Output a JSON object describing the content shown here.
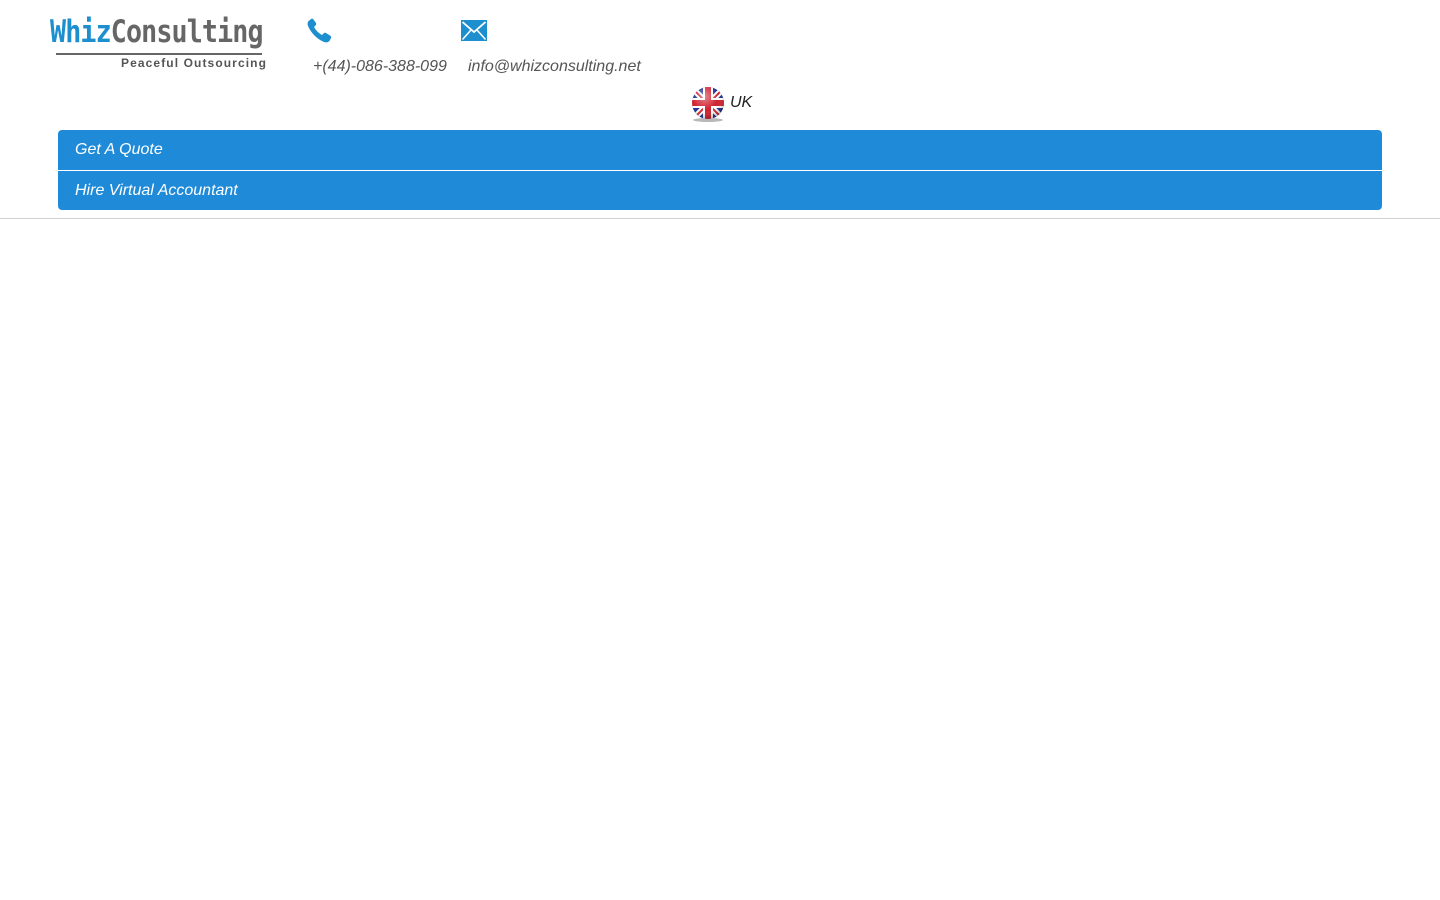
{
  "logo": {
    "whiz": "Whiz",
    "consulting": "Consulting",
    "tagline": "Peaceful Outsourcing"
  },
  "contact": {
    "phone": "+(44)-086-388-099",
    "email": "info@whizconsulting.net",
    "phone_icon": "phone-icon",
    "email_icon": "envelope-icon"
  },
  "country": {
    "label": "UK",
    "flag_icon": "uk-flag-icon"
  },
  "nav": {
    "items": [
      {
        "label": "Get A Quote"
      },
      {
        "label": "Hire Virtual Accountant"
      }
    ]
  },
  "colors": {
    "accent": "#1f8bd8",
    "logo_blue": "#1e8fce",
    "text_gray": "#555555"
  }
}
